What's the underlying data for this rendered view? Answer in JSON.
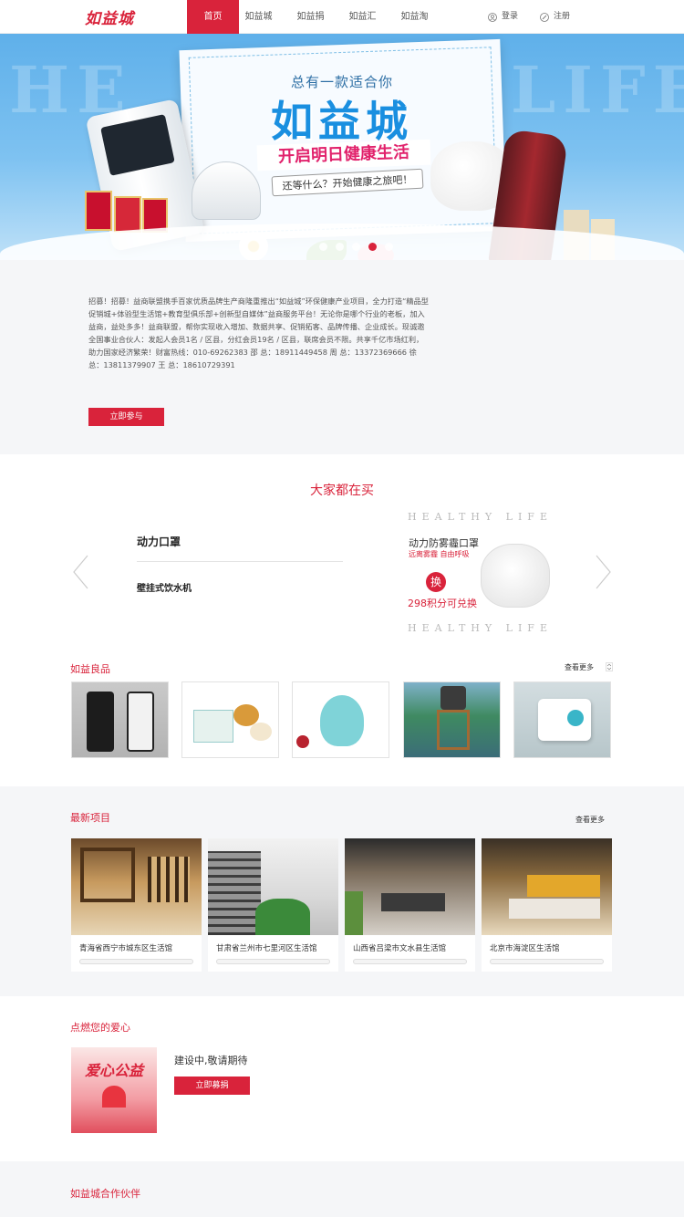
{
  "header": {
    "logo": "如益城",
    "nav": [
      "首页",
      "如益城",
      "如益捐",
      "如益汇",
      "如益淘"
    ],
    "active_index": 0,
    "login": "登录",
    "register": "注册"
  },
  "banner": {
    "bg_text_left": "HE",
    "bg_text_right": "LIFE",
    "tagline": "总有一款适合你",
    "title": "如益城",
    "slogan": "开启明日健康生活",
    "sub_slogan": "还等什么？开始健康之旅吧！",
    "slides": 5,
    "active_slide": 4
  },
  "intro": {
    "text": "招募！招募！益商联盟携手百家优质品牌生产商隆重推出“如益城”环保健康产业项目，全力打造“精品型促销城+体验型生活馆+教育型俱乐部+创新型自媒体”益商服务平台！无论你是哪个行业的老板，加入益商，益处多多！益商联盟，帮你实现收入增加、数据共享、促销拓客、品牌传播、企业成长。现诚邀全国事业合伙人：发起人会员1名 / 区县，分红会员19名 / 区县，联席会员不限。共享千亿市场红利，助力国家经济繁荣！财富热线：010-69262383 邵  总：18911449458 周  总：13372369666 徐  总：13811379907 王  总：18610729391",
    "join_button": "立即参与"
  },
  "popular": {
    "title": "大家都在买",
    "items": [
      "动力口罩",
      "壁挂式饮水机"
    ],
    "promo": {
      "deco_text": "HEALTHY LIFE",
      "name": "动力防雾霾口罩",
      "sub": "远离雾霾 自由呼吸",
      "badge": "换",
      "price": "298积分可兑换"
    }
  },
  "goods": {
    "title": "如益良品",
    "more": "查看更多",
    "items": [
      "空气净化器",
      "食品礼盒",
      "加湿器",
      "净水桶",
      "壁挂净化器"
    ]
  },
  "projects": {
    "title": "最新项目",
    "more": "查看更多",
    "items": [
      "青海省西宁市城东区生活馆",
      "甘肃省兰州市七里河区生活馆",
      "山西省吕梁市文水县生活馆",
      "北京市海淀区生活馆"
    ]
  },
  "love": {
    "title": "点燃您的爱心",
    "image_text": "爱心公益",
    "status": "建设中,敬请期待",
    "donate_button": "立即募捐"
  },
  "partners": {
    "title": "如益城合作伙伴"
  },
  "colors": {
    "brand_red": "#d9233b",
    "banner_blue": "#5fb0ea",
    "light_bg": "#f5f6f8"
  }
}
